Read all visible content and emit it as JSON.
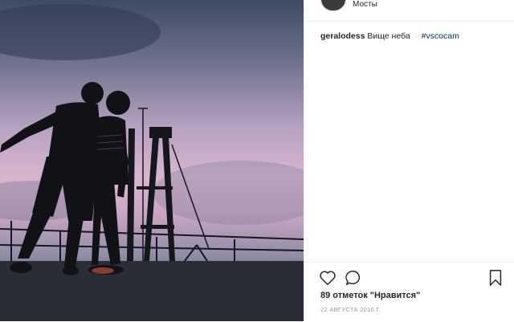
{
  "post": {
    "location": "Мосты",
    "username": "geralodess",
    "caption_text": "Вище неба",
    "caption_heart": "♡",
    "hashtag": "#vscocam",
    "likes_text": "89 отметок \"Нравится\"",
    "date": "22 АВГУСТА 2016 Г."
  },
  "icons": {
    "like": "heart-outline-icon",
    "comment": "speech-bubble-icon",
    "save": "bookmark-icon"
  },
  "colors": {
    "hashtag": "#003569",
    "text": "#262626",
    "muted": "#999999"
  }
}
